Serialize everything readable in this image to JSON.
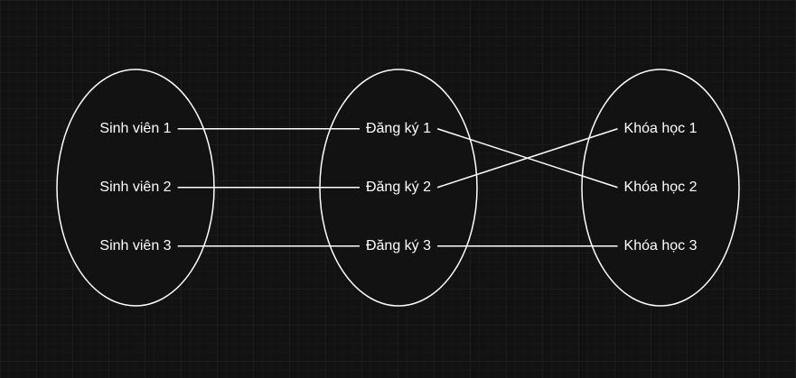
{
  "diagram": {
    "sets": [
      {
        "id": "students",
        "items": [
          "Sinh viên 1",
          "Sinh viên 2",
          "Sinh viên 3"
        ]
      },
      {
        "id": "registrations",
        "items": [
          "Đăng ký 1",
          "Đăng ký 2",
          "Đăng ký 3"
        ]
      },
      {
        "id": "courses",
        "items": [
          "Khóa học 1",
          "Khóa học 2",
          "Khóa học 3"
        ]
      }
    ],
    "mappings": [
      {
        "from": [
          "students",
          0
        ],
        "to": [
          "registrations",
          0
        ]
      },
      {
        "from": [
          "students",
          1
        ],
        "to": [
          "registrations",
          1
        ]
      },
      {
        "from": [
          "students",
          2
        ],
        "to": [
          "registrations",
          2
        ]
      },
      {
        "from": [
          "registrations",
          0
        ],
        "to": [
          "courses",
          1
        ]
      },
      {
        "from": [
          "registrations",
          1
        ],
        "to": [
          "courses",
          0
        ]
      },
      {
        "from": [
          "registrations",
          2
        ],
        "to": [
          "courses",
          2
        ]
      }
    ],
    "colors": {
      "background": "#121212",
      "grid": "#1f1f1f",
      "stroke": "#ffffff",
      "text": "#ffffff"
    }
  }
}
